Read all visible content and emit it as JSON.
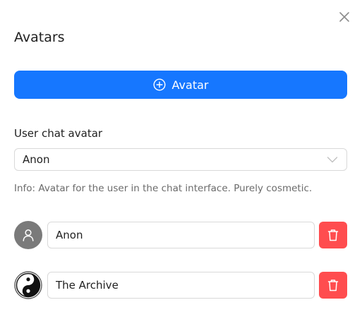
{
  "dialog": {
    "title": "Avatars",
    "add_button_label": "Avatar",
    "user_avatar": {
      "label": "User chat avatar",
      "selected": "Anon",
      "info": "Info: Avatar for the user in the chat interface. Purely cosmetic."
    },
    "avatars": [
      {
        "name": "Anon",
        "icon": "user-icon",
        "avatar_color": "#7a7a7a"
      },
      {
        "name": "The Archive",
        "icon": "yin-yang-icon"
      }
    ]
  },
  "colors": {
    "primary": "#1677ff",
    "danger": "#ff4d4f",
    "border": "#d9d9d9",
    "muted_text": "#6b6b6b"
  }
}
